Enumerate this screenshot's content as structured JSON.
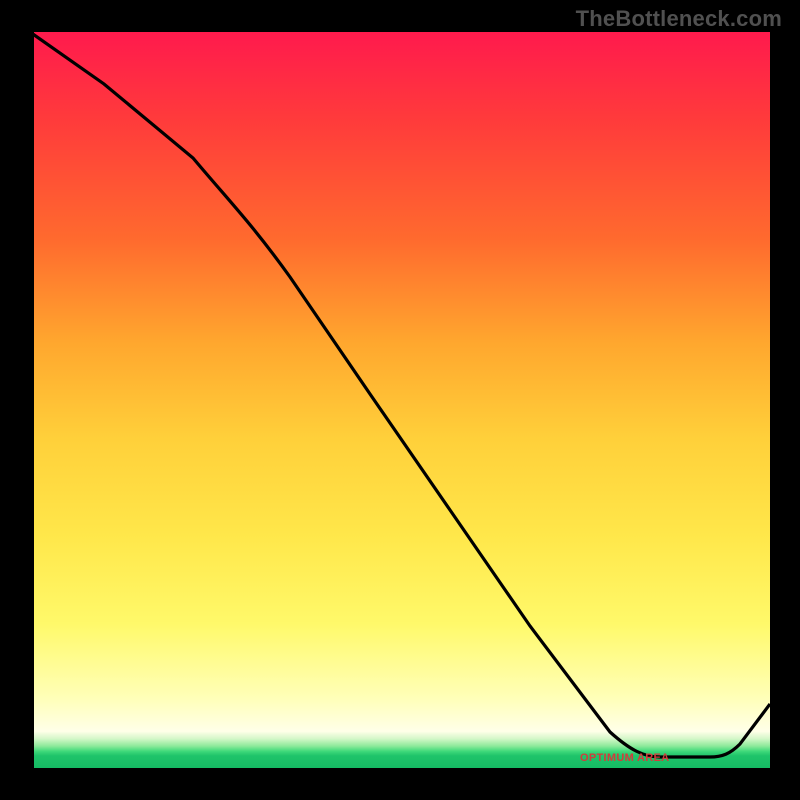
{
  "watermark": "TheBottleneck.com",
  "bottom_label": "OPTIMUM AREA",
  "chart_data": {
    "type": "line",
    "title": "",
    "xlabel": "",
    "ylabel": "",
    "xlim": [
      0,
      100
    ],
    "ylim": [
      0,
      100
    ],
    "series": [
      {
        "name": "curve",
        "x": [
          0,
          10,
          22,
          30,
          40,
          50,
          60,
          70,
          80,
          83,
          88,
          92,
          100
        ],
        "values": [
          100,
          93,
          83,
          74,
          60,
          46,
          32,
          18,
          5,
          2,
          2,
          2,
          10
        ]
      }
    ],
    "annotations": [
      {
        "name": "optimum-area",
        "x": 87,
        "y": 2,
        "text": "OPTIMUM AREA"
      }
    ],
    "background_gradient": {
      "direction": "vertical",
      "stops": [
        {
          "pos": 0.0,
          "color": "#ff1a4d"
        },
        {
          "pos": 0.28,
          "color": "#ff6a2e"
        },
        {
          "pos": 0.55,
          "color": "#ffd03a"
        },
        {
          "pos": 0.8,
          "color": "#fff96a"
        },
        {
          "pos": 0.94,
          "color": "#ffffe8"
        },
        {
          "pos": 0.97,
          "color": "#3fd97a"
        },
        {
          "pos": 1.0,
          "color": "#12b862"
        }
      ]
    }
  }
}
